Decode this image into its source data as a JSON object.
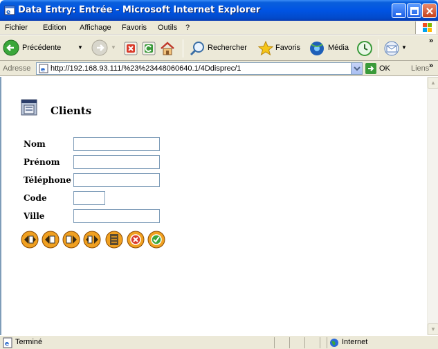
{
  "window": {
    "title": "Data Entry: Entrée - Microsoft Internet Explorer"
  },
  "menu": {
    "items": [
      "Fichier",
      "Edition",
      "Affichage",
      "Favoris",
      "Outils",
      "?"
    ]
  },
  "toolbar": {
    "back_label": "Précédente",
    "search_label": "Rechercher",
    "favorites_label": "Favoris",
    "media_label": "Média",
    "overflow": "»"
  },
  "address": {
    "label": "Adresse",
    "url": "http://192.168.93.111/%23%23448060640.1/4Ddisprec/1",
    "go_label": "OK",
    "links_label": "Liens"
  },
  "page": {
    "title": "Clients",
    "fields": [
      {
        "label": "Nom",
        "value": ""
      },
      {
        "label": "Prénom",
        "value": ""
      },
      {
        "label": "Téléphone",
        "value": ""
      },
      {
        "label": "Code",
        "value": ""
      },
      {
        "label": "Ville",
        "value": ""
      }
    ],
    "nav_buttons": [
      "first-record-icon",
      "previous-record-icon",
      "next-record-icon",
      "last-record-icon",
      "list-icon",
      "cancel-icon",
      "validate-icon"
    ]
  },
  "status": {
    "text": "Terminé",
    "zone": "Internet"
  },
  "colors": {
    "titlebar": "#0054e3",
    "chrome": "#ece9d8",
    "nav_button_orange": "#f0a020"
  }
}
